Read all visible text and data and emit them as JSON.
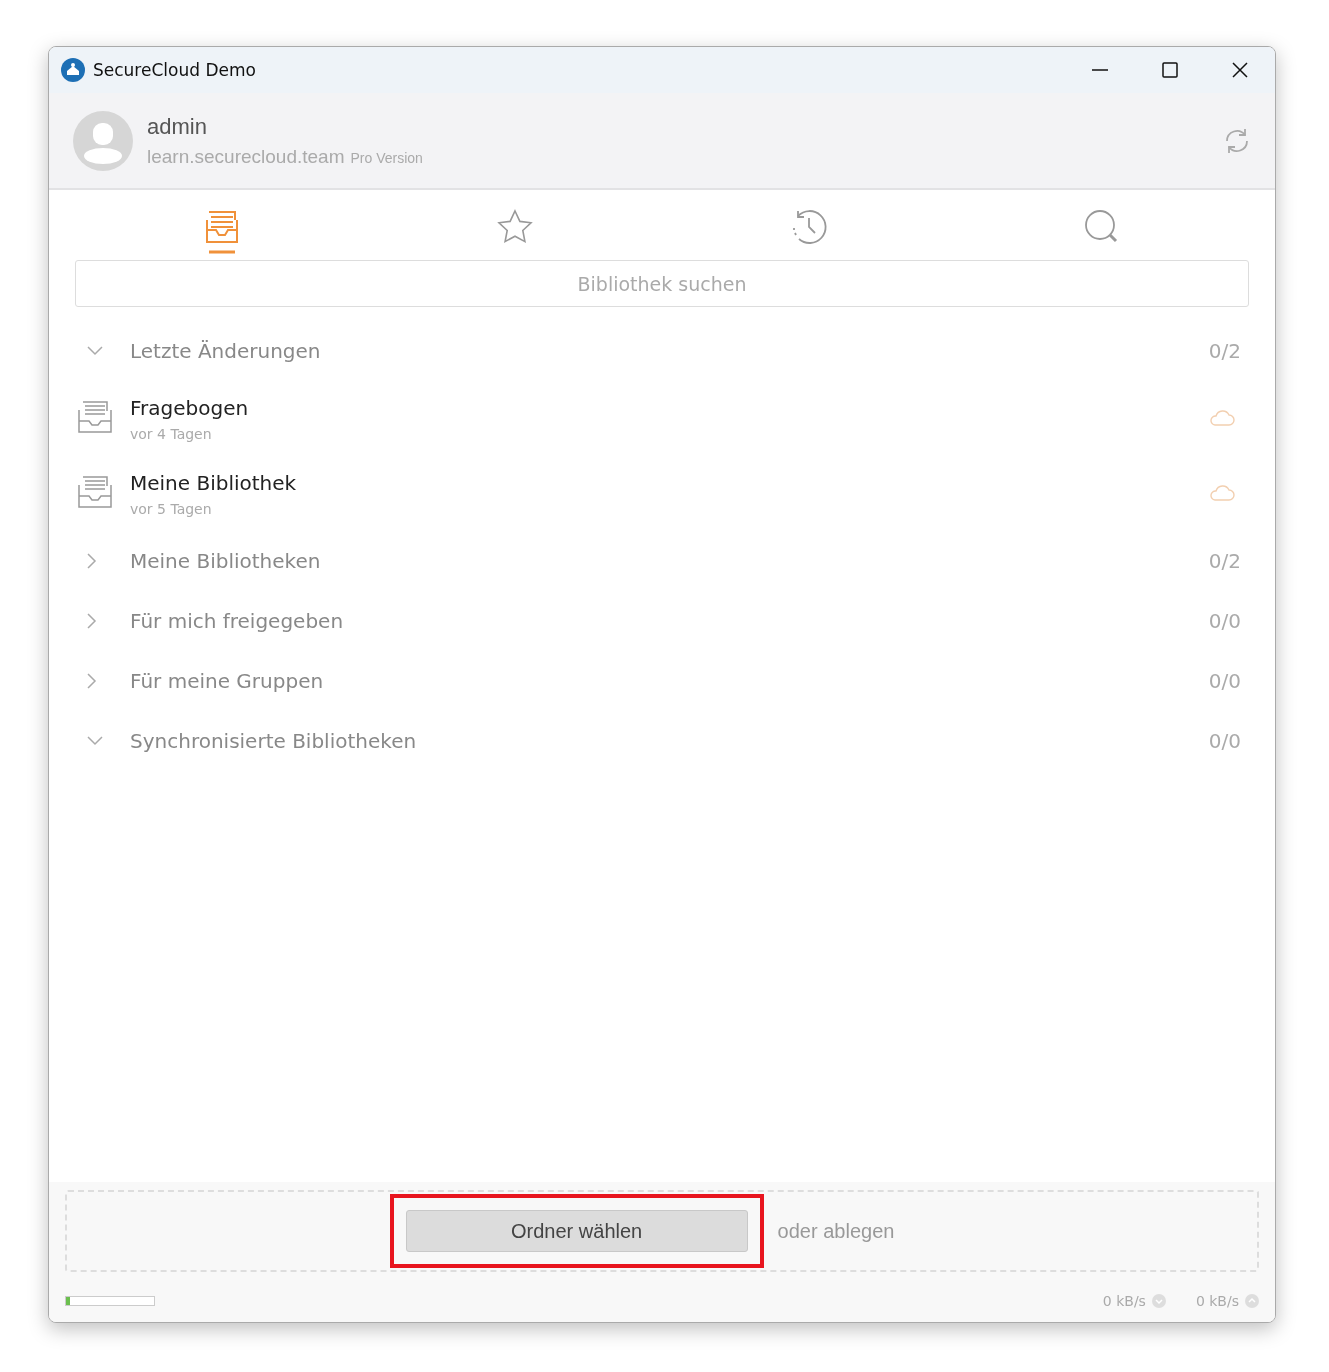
{
  "window": {
    "title": "SecureCloud Demo"
  },
  "account": {
    "name": "admin",
    "server": "learn.securecloud.team",
    "edition": "Pro Version"
  },
  "tabs": [
    {
      "kind": "libraries",
      "selected": true
    },
    {
      "kind": "starred",
      "selected": false
    },
    {
      "kind": "history",
      "selected": false
    },
    {
      "kind": "search",
      "selected": false
    }
  ],
  "search": {
    "placeholder": "Bibliothek suchen"
  },
  "sections": [
    {
      "label": "Letzte Änderungen",
      "count": "0/2",
      "expanded": true,
      "children": [
        {
          "name": "Fragebogen",
          "time": "vor 4 Tagen"
        },
        {
          "name": "Meine Bibliothek",
          "time": "vor 5 Tagen"
        }
      ]
    },
    {
      "label": "Meine Bibliotheken",
      "count": "0/2",
      "expanded": false
    },
    {
      "label": "Für mich freigegeben",
      "count": "0/0",
      "expanded": false
    },
    {
      "label": "Für meine Gruppen",
      "count": "0/0",
      "expanded": false
    },
    {
      "label": "Synchronisierte Bibliotheken",
      "count": "0/0",
      "expanded": true
    }
  ],
  "drop_zone": {
    "button": "Ordner wählen",
    "text": "oder ablegen",
    "highlighted": true
  },
  "status_bar": {
    "progress": {
      "level": 0.05
    },
    "download": "0 kB/s",
    "upload": "0 kB/s"
  }
}
